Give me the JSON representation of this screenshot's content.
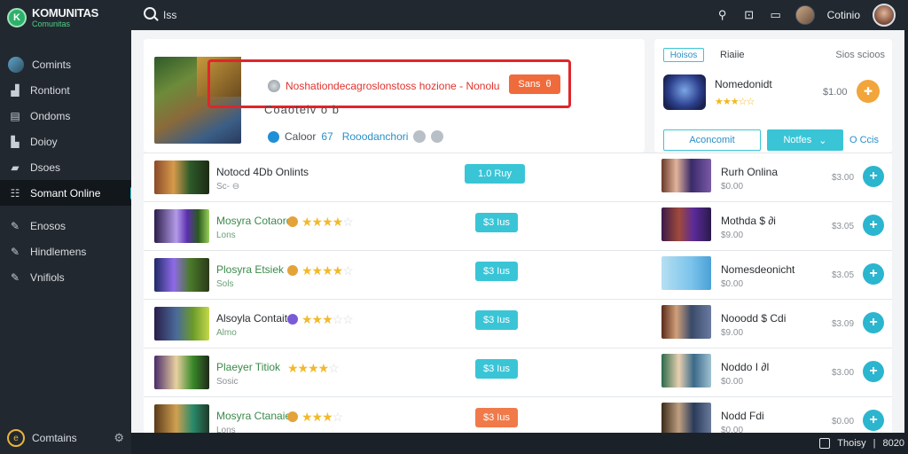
{
  "brand": {
    "name": "KOMUNITAS",
    "sub": "Comunitas"
  },
  "topbar": {
    "search_text": "Iss",
    "user_name": "Cotinio"
  },
  "sidebar": {
    "items": [
      {
        "label": "Comints",
        "icon": "avatar-icon"
      },
      {
        "label": "Rontiont",
        "icon": "person-icon"
      },
      {
        "label": "Ondoms",
        "icon": "pages-icon"
      },
      {
        "label": "Doioy",
        "icon": "book-icon"
      },
      {
        "label": "Dsoes",
        "icon": "folder-icon"
      },
      {
        "label": "Somant Online",
        "icon": "grid-icon",
        "active": true
      },
      {
        "label": "Enosos",
        "icon": "wrench-icon"
      },
      {
        "label": "Hindlemens",
        "icon": "wrench-icon"
      },
      {
        "label": "Vnifiols",
        "icon": "wrench-icon"
      }
    ],
    "footer_label": "Comtains"
  },
  "featured": {
    "title": "Noshationdecagroslonstoss hozione - Nonolu",
    "button_label": "Sans",
    "button_glyph": "θ",
    "subtitle": "Coaoteiv o b",
    "meta_label": "Caloor",
    "meta_num": "67",
    "meta_secondary": "Rooodanchori"
  },
  "right_panel": {
    "tab_active": "Hoisos",
    "tab_label": "Riaiie",
    "tab_right": "Sios scioos",
    "app_name": "Nomedonidt",
    "app_price": "$1.00",
    "stars": "★★★☆☆",
    "btn_secondary": "Aconcomit",
    "btn_primary": "Notfes",
    "link": "O Ccis"
  },
  "rows": [
    {
      "name": "Notocd 4Db Onlints",
      "sub": "Sc- ⊖",
      "rating": null,
      "green": false,
      "pill": "1.0 Ruy",
      "pill_orange": false,
      "right_name": "Rurh Onlina",
      "right_sub": "$0.00",
      "right_price": "$3.00"
    },
    {
      "name": "Mosyra Cotaord",
      "sub": "Lons",
      "rating": 5,
      "green": true,
      "pill": "$3 Ius",
      "pill_orange": false,
      "right_name": "Mothda $ ∂i",
      "right_sub": "$9.00",
      "right_price": "$3.05"
    },
    {
      "name": "Plosyra Etsiek",
      "sub": "Sols",
      "rating": 5,
      "green": true,
      "pill": "$3 Ius",
      "pill_orange": false,
      "right_name": "Nomesdeonicht",
      "right_sub": "$0.00",
      "right_price": "$3.05"
    },
    {
      "name": "Alsoyla Contaite",
      "sub": "Almo",
      "rating": 4,
      "green": false,
      "pill": "$3 Ius",
      "pill_orange": false,
      "right_name": "Nooodd $ Cdi",
      "right_sub": "$9.00",
      "right_price": "$3.09"
    },
    {
      "name": "Plaeyer Titiok",
      "sub": "Sosic",
      "rating": 5,
      "green": true,
      "pill": "$3 Ius",
      "pill_orange": false,
      "right_name": "Noddo I ∂I",
      "right_sub": "$0.00",
      "right_price": "$3.00"
    },
    {
      "name": "Mosyra Ctanaie",
      "sub": "Lons",
      "rating": 4,
      "green": true,
      "pill": "$3 Ius",
      "pill_orange": true,
      "right_name": "Nodd Fdi",
      "right_sub": "$0.00",
      "right_price": "$0.00"
    }
  ],
  "bottom_bar": {
    "text": "Thoisy",
    "time": "8020"
  }
}
